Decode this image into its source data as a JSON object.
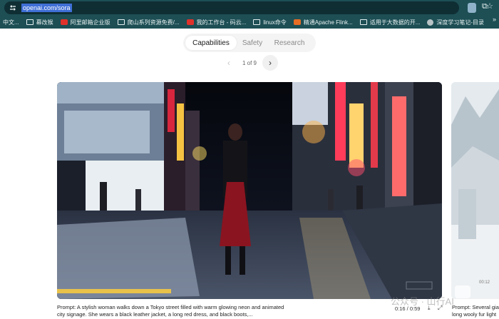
{
  "browser": {
    "url": "openai.com/sora",
    "bookmarks": [
      {
        "label": "中文...",
        "icon": "none"
      },
      {
        "label": "幕改猴",
        "icon": "folder-icon"
      },
      {
        "label": "阿里邮箱企业版",
        "icon": "mail-icon"
      },
      {
        "label": "爬山系列资源免费/...",
        "icon": "folder-icon"
      },
      {
        "label": "我的工作台 - 码云...",
        "icon": "gitee-icon"
      },
      {
        "label": "linux命令",
        "icon": "folder-icon"
      },
      {
        "label": "精通Apache Flink...",
        "icon": "book-icon"
      },
      {
        "label": "适用于大数据的开...",
        "icon": "folder-icon"
      },
      {
        "label": "深度学习笔记-目录",
        "icon": "globe-icon"
      }
    ],
    "more": "»"
  },
  "tabs": [
    "Capabilities",
    "Safety",
    "Research"
  ],
  "pager": {
    "text": "1 of 9",
    "prev": "‹",
    "next": "›"
  },
  "video": {
    "prompt": "Prompt: A stylish woman walks down a Tokyo street filled with warm glowing neon and animated city signage. She wears a black leather jacket, a long red dress, and black boots,...",
    "time": "0:16 / 0:59"
  },
  "side_video": {
    "prompt_line1": "Prompt: Several gia",
    "prompt_line2": "long wooly fur light",
    "time": "00:12"
  },
  "watermark": "公众号 · 山行AI"
}
